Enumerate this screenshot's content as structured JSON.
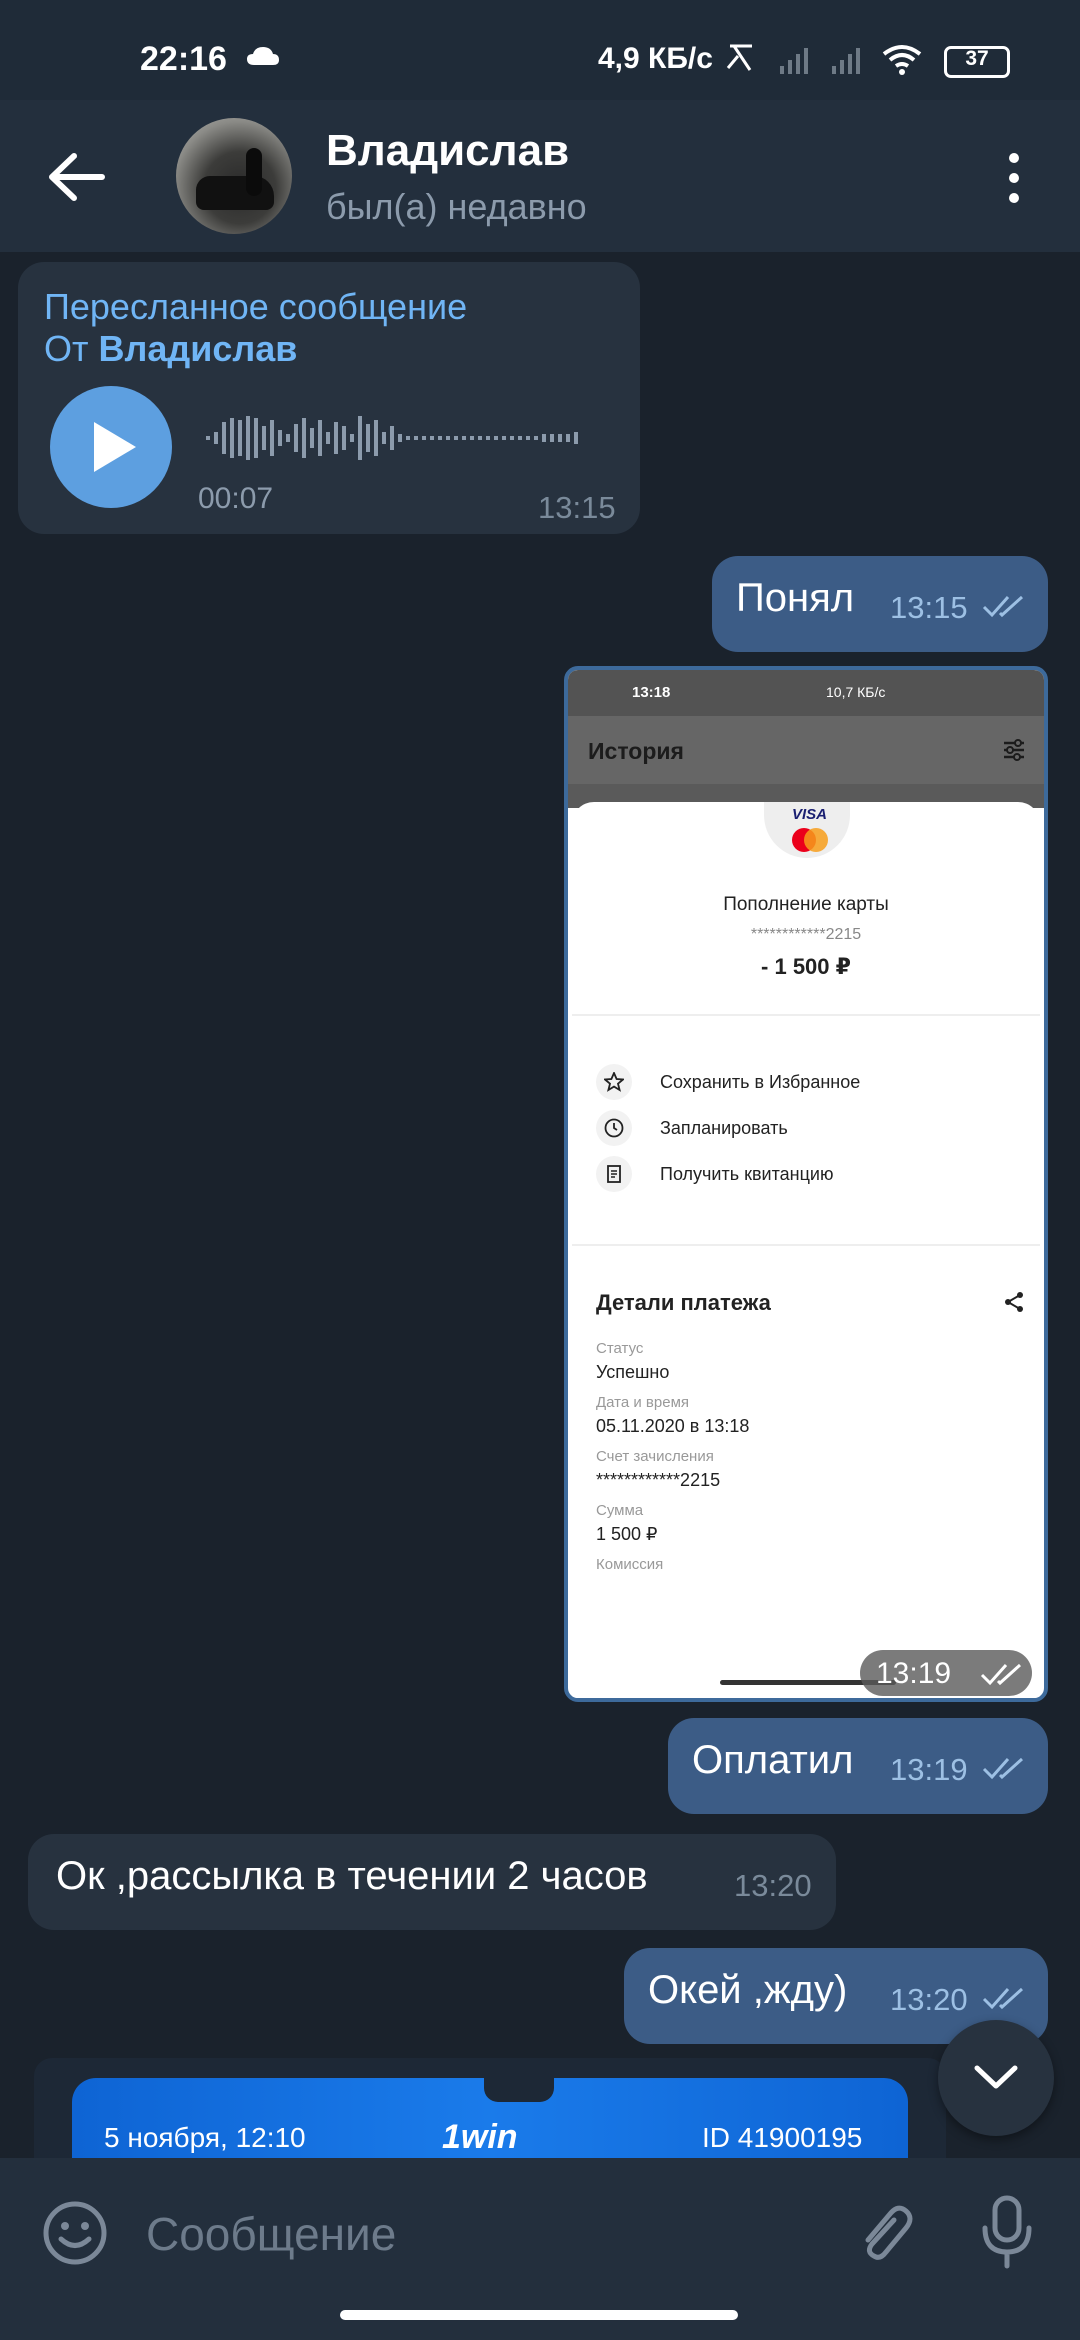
{
  "status_bar": {
    "time": "22:16",
    "net_speed": "4,9 КБ/с",
    "battery": "37"
  },
  "header": {
    "name": "Владислав",
    "status": "был(а) недавно"
  },
  "messages": {
    "forwarded": {
      "title": "Пересланное сообщение",
      "from_prefix": "От ",
      "from_name": "Владислав",
      "duration": "00:07",
      "time": "13:15"
    },
    "m1": {
      "text": "Понял",
      "time": "13:15"
    },
    "photo": {
      "time": "13:19",
      "screen": {
        "status_time": "13:18",
        "status_speed": "10,7 КБ/с",
        "title": "История",
        "card_brand": "VISA",
        "card_title": "Пополнение карты",
        "card_number": "************2215",
        "amount": "- 1 500 ₽",
        "actions": [
          "Сохранить в Избранное",
          "Запланировать",
          "Получить квитанцию"
        ],
        "details_title": "Детали платежа",
        "details": [
          {
            "label": "Статус",
            "value": "Успешно"
          },
          {
            "label": "Дата и время",
            "value": "05.11.2020 в 13:18"
          },
          {
            "label": "Счет зачисления",
            "value": "************2215"
          },
          {
            "label": "Сумма",
            "value": "1 500 ₽"
          },
          {
            "label": "Комиссия",
            "value": ""
          }
        ]
      }
    },
    "m2": {
      "text": "Оплатил",
      "time": "13:19"
    },
    "m3": {
      "text": "Ок ,рассылка в течении 2 часов",
      "time": "13:20"
    },
    "m4": {
      "text": "Окей ,жду)",
      "time": "13:20"
    },
    "preview": {
      "date": "5 ноября, 12:10",
      "logo": "1win",
      "id": "ID 41900195"
    }
  },
  "composer": {
    "placeholder": "Сообщение"
  },
  "colors": {
    "background": "#1a222c",
    "header": "#232f3d",
    "incoming": "#27323f",
    "outgoing": "#3c5c86",
    "link": "#70b5f5"
  }
}
